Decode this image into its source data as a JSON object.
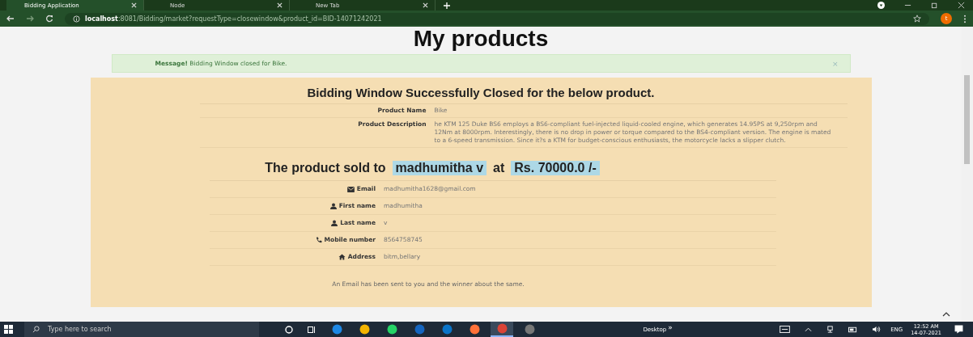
{
  "browser": {
    "tabs": [
      {
        "label": "Bidding Application",
        "selected": true
      },
      {
        "label": "Node",
        "selected": false
      },
      {
        "label": "New Tab",
        "selected": false
      }
    ],
    "url_host": "localhost",
    "url_rest": ":8081/Bidding/market?requestType=closewindow&product_id=BID-14071242021",
    "profile_initial": "t"
  },
  "page": {
    "heading": "My products",
    "alert": {
      "strong": "Message!",
      "text": "Bidding Window closed for Bike.",
      "close": "×"
    },
    "card": {
      "title": "Bidding Window Successfully Closed for the below product.",
      "product_rows": [
        {
          "label": "Product Name",
          "value": "Bike"
        },
        {
          "label": "Product Description",
          "value": "he KTM 125 Duke BS6 employs a BS6-compliant fuel-injected liquid-cooled engine, which generates 14.95PS at 9,250rpm and 12Nm at 8000rpm. Interestingly, there is no drop in power or torque compared to the BS4-compliant version. The engine is mated to a 6-speed transmission. Since it?s a KTM for budget-conscious enthusiasts, the motorcycle lacks a slipper clutch."
        }
      ],
      "sold_prefix": "The product sold to",
      "winner": "madhumitha v",
      "sold_mid": "at",
      "price": "Rs. 70000.0 /-",
      "winner_rows": [
        {
          "kind": "email",
          "label": "Email",
          "value": "madhumitha1628@gmail.com"
        },
        {
          "kind": "user",
          "label": "First name",
          "value": "madhumitha"
        },
        {
          "kind": "user",
          "label": "Last name",
          "value": "v"
        },
        {
          "kind": "phone",
          "label": "Mobile number",
          "value": "8564758745"
        },
        {
          "kind": "home",
          "label": "Address",
          "value": "bitm,bellary"
        }
      ],
      "footer_note": "An Email has been sent to you and the winner about the same."
    }
  },
  "taskbar": {
    "search_placeholder": "Type here to search",
    "apps": [
      {
        "selected": false
      },
      {
        "selected": false
      },
      {
        "selected": false
      },
      {
        "selected": false
      },
      {
        "selected": false
      },
      {
        "selected": false
      },
      {
        "selected": true
      },
      {
        "selected": false
      }
    ],
    "desktop_label": "Desktop",
    "chevron": "»",
    "language": "ENG",
    "time": "12:52 AM",
    "date": "14-07-2021"
  }
}
